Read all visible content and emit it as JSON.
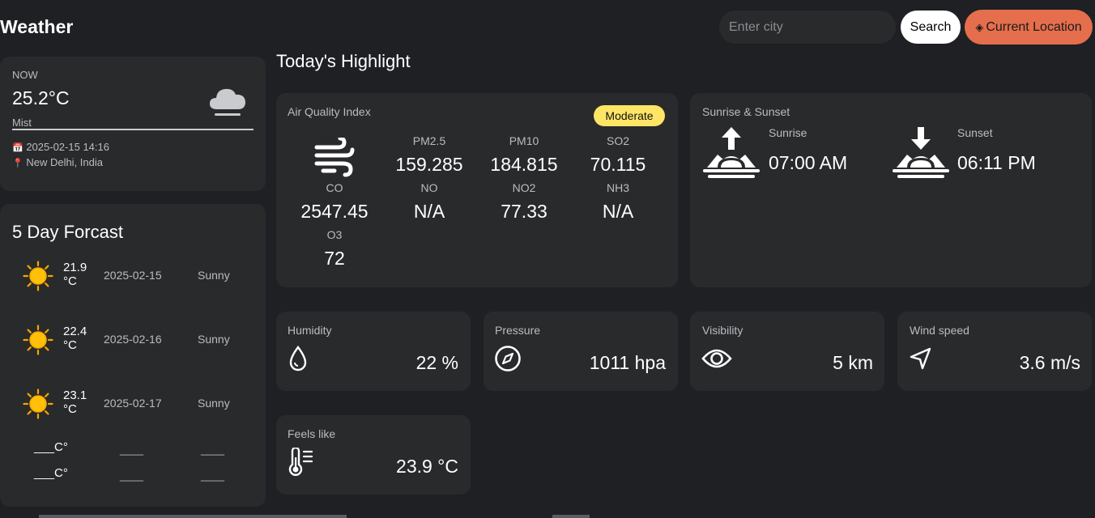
{
  "header": {
    "app_title": "Weather",
    "search_placeholder": "Enter city",
    "search_label": "Search",
    "location_label": "Current Location",
    "location_icon": "◈"
  },
  "current": {
    "now_label": "NOW",
    "temp": "25.2°C",
    "condition": "Mist",
    "date": "2025-02-15 14:16",
    "location": "New Delhi, India",
    "calendar_icon": "📅",
    "pin_icon": "📍"
  },
  "forecast": {
    "title": "5 Day Forcast",
    "days": [
      {
        "temp_value": "21.9",
        "temp_unit": "°C",
        "date": "2025-02-15",
        "desc": "Sunny"
      },
      {
        "temp_value": "22.4",
        "temp_unit": "°C",
        "date": "2025-02-16",
        "desc": "Sunny"
      },
      {
        "temp_value": "23.1",
        "temp_unit": "°C",
        "date": "2025-02-17",
        "desc": "Sunny"
      }
    ],
    "placeholder_temp": "___C°",
    "placeholder_blank": "____"
  },
  "highlights": {
    "title": "Today's Highlight",
    "aqi": {
      "label": "Air Quality Index",
      "badge": "Moderate",
      "badge_color": "#ffe566",
      "pm25_label": "PM2.5",
      "pm25": "159.285",
      "pm10_label": "PM10",
      "pm10": "184.815",
      "so2_label": "SO2",
      "so2": "70.115",
      "co_label": "CO",
      "co": "2547.45",
      "no_label": "NO",
      "no": "N/A",
      "no2_label": "NO2",
      "no2": "77.33",
      "nh3_label": "NH3",
      "nh3": "N/A",
      "o3_label": "O3",
      "o3": "72"
    },
    "sun": {
      "label": "Sunrise & Sunset",
      "sunrise_label": "Sunrise",
      "sunrise": "07:00 AM",
      "sunset_label": "Sunset",
      "sunset": "06:11 PM"
    },
    "humidity": {
      "label": "Humidity",
      "value": "22 %"
    },
    "pressure": {
      "label": "Pressure",
      "value": "1011 hpa"
    },
    "visibility": {
      "label": "Visibility",
      "value": "5 km"
    },
    "wind": {
      "label": "Wind speed",
      "value": "3.6 m/s"
    },
    "feels": {
      "label": "Feels like",
      "value": "23.9 °C"
    }
  },
  "colors": {
    "accent": "#e56e4c",
    "card": "#292a2c",
    "background": "#1e2024",
    "sun": "#ffc107"
  }
}
